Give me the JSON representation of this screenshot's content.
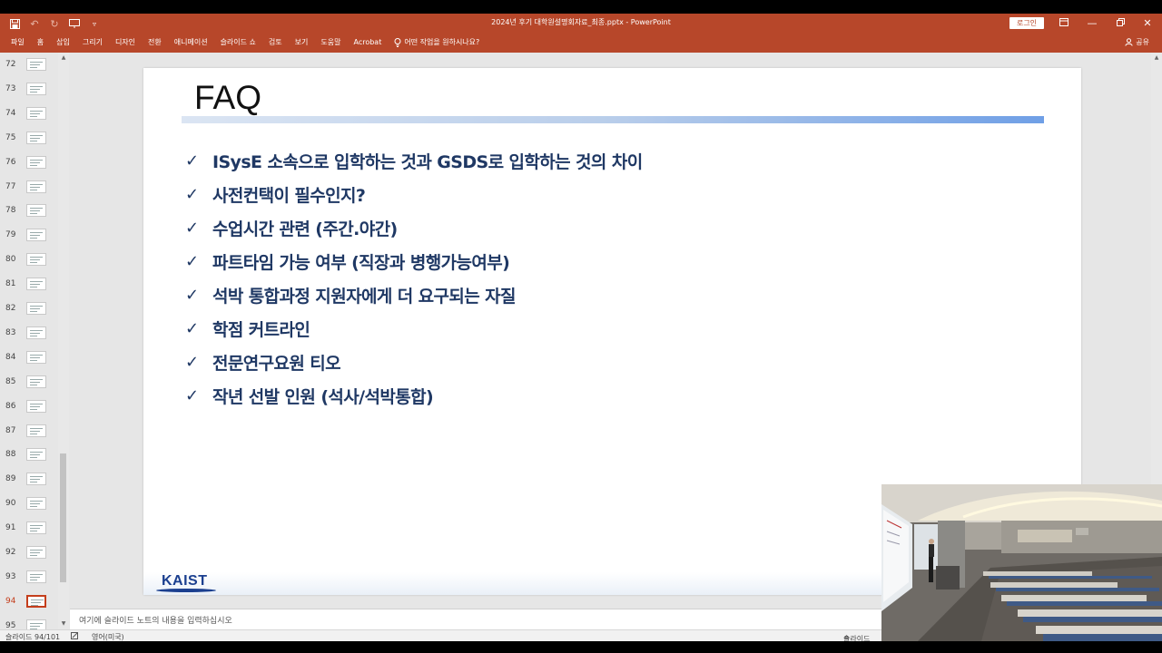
{
  "window": {
    "title": "2024년 후기 대학원설명회자료_최종.pptx  -  PowerPoint",
    "login_label": "로그인",
    "controls": [
      "ribbon-display-icon",
      "minimize-icon",
      "restore-icon",
      "close-icon"
    ]
  },
  "quick_access": [
    "save-icon",
    "undo-icon",
    "redo-icon",
    "slideshow-start-icon",
    "customize-icon"
  ],
  "ribbon": {
    "tabs": [
      "파일",
      "홈",
      "삽입",
      "그리기",
      "디자인",
      "전환",
      "애니메이션",
      "슬라이드 쇼",
      "검토",
      "보기",
      "도움말",
      "Acrobat"
    ],
    "tell_me": "어떤 작업을 원하시나요?",
    "share": "공유"
  },
  "thumbnails": {
    "numbers": [
      "72",
      "73",
      "74",
      "75",
      "76",
      "77",
      "78",
      "79",
      "80",
      "81",
      "82",
      "83",
      "84",
      "85",
      "86",
      "87",
      "88",
      "89",
      "90",
      "91",
      "92",
      "93",
      "94",
      "95"
    ],
    "active": "94"
  },
  "slide": {
    "title": "FAQ",
    "bullet_glyph": "✓",
    "items": [
      "ISysE 소속으로 입학하는 것과 GSDS로 입학하는 것의 차이",
      "사전컨택이 필수인지?",
      "수업시간 관련 (주간.야간)",
      "파트타임 가능 여부 (직장과 병행가능여부)",
      "석박 통합과정 지원자에게 더 요구되는 자질",
      "학점 커트라인",
      "전문연구요원 티오",
      "작년 선발 인원 (석사/석박통합)"
    ],
    "logo_text": "KAIST"
  },
  "notes": {
    "placeholder": "여기에 슬라이드 노트의 내용을 입력하십시오"
  },
  "status": {
    "slide_info": "슬라이드 94/101",
    "language": "영어(미국)",
    "notes_toggle": "슬라이드"
  },
  "colors": {
    "accent": "#b7472a",
    "bullet_text": "#1f3864",
    "kaist_blue": "#1b3f8f"
  }
}
